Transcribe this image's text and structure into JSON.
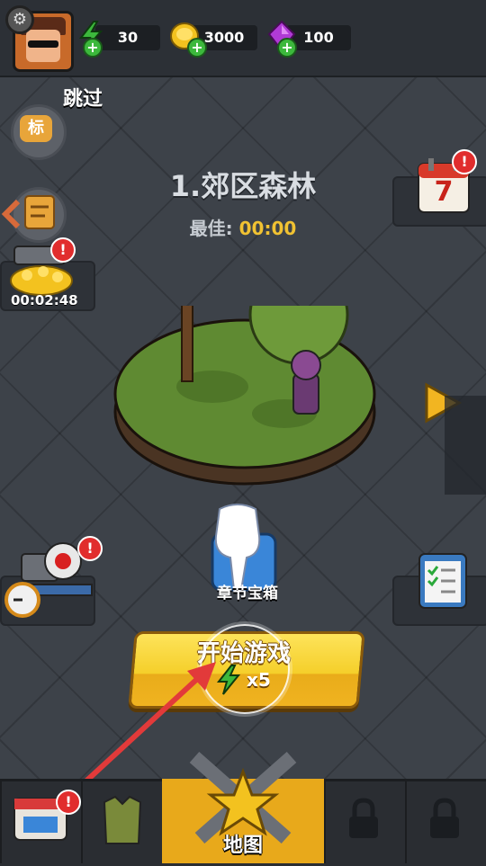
{
  "header": {
    "energy": "30",
    "gold": "3000",
    "gems": "100"
  },
  "skip_label": "跳过",
  "left_buttons": {
    "tag_label": "标"
  },
  "chest_timer": "00:02:48",
  "level": {
    "title": "1.郊区森林",
    "best_label": "最佳:",
    "best_value": "00:00"
  },
  "calendar_day": "7",
  "chapter_chest_label": "章节宝箱",
  "start": {
    "label": "开始游戏",
    "cost": "x5"
  },
  "bottom_tabs": {
    "map_label": "地图"
  },
  "alerts": {
    "mark": "!"
  },
  "colors": {
    "accent_yellow": "#f5cf2a",
    "alert_red": "#e12d2d",
    "energy_green": "#3cb83c",
    "gem_purple": "#b03ad6"
  }
}
